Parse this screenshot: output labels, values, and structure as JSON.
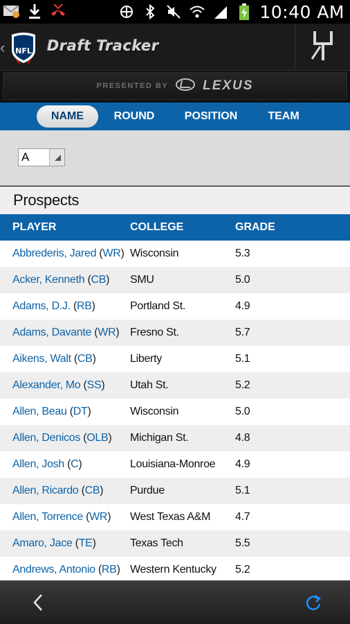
{
  "status_bar": {
    "time": "10:40 AM",
    "icons": [
      "gmail-icon",
      "download-icon",
      "missed-call-icon",
      "nfc-icon",
      "bluetooth-icon",
      "mute-icon",
      "wifi-icon",
      "signal-icon",
      "battery-charging-icon"
    ]
  },
  "header": {
    "title": "Draft Tracker",
    "logo": "nfl-shield-logo",
    "sponsor_label": "PRESENTED BY",
    "sponsor_name": "LEXUS"
  },
  "tabs": [
    {
      "label": "NAME",
      "active": true
    },
    {
      "label": "ROUND",
      "active": false
    },
    {
      "label": "POSITION",
      "active": false
    },
    {
      "label": "TEAM",
      "active": false
    }
  ],
  "filter": {
    "selected_letter": "A"
  },
  "prospects": {
    "title": "Prospects",
    "columns": {
      "player": "PLAYER",
      "college": "COLLEGE",
      "grade": "GRADE"
    },
    "rows": [
      {
        "name": "Abbrederis, Jared",
        "pos": "WR",
        "college": "Wisconsin",
        "grade": "5.3"
      },
      {
        "name": "Acker, Kenneth",
        "pos": "CB",
        "college": "SMU",
        "grade": "5.0"
      },
      {
        "name": "Adams, D.J.",
        "pos": "RB",
        "college": "Portland St.",
        "grade": "4.9"
      },
      {
        "name": "Adams, Davante",
        "pos": "WR",
        "college": "Fresno St.",
        "grade": "5.7"
      },
      {
        "name": "Aikens, Walt",
        "pos": "CB",
        "college": "Liberty",
        "grade": "5.1"
      },
      {
        "name": "Alexander, Mo",
        "pos": "SS",
        "college": "Utah St.",
        "grade": "5.2"
      },
      {
        "name": "Allen, Beau",
        "pos": "DT",
        "college": "Wisconsin",
        "grade": "5.0"
      },
      {
        "name": "Allen, Denicos",
        "pos": "OLB",
        "college": "Michigan St.",
        "grade": "4.8"
      },
      {
        "name": "Allen, Josh",
        "pos": "C",
        "college": "Louisiana-Monroe",
        "grade": "4.9"
      },
      {
        "name": "Allen, Ricardo",
        "pos": "CB",
        "college": "Purdue",
        "grade": "5.1"
      },
      {
        "name": "Allen, Torrence",
        "pos": "WR",
        "college": "West Texas A&M",
        "grade": "4.7"
      },
      {
        "name": "Amaro, Jace",
        "pos": "TE",
        "college": "Texas Tech",
        "grade": "5.5"
      },
      {
        "name": "Andrews, Antonio",
        "pos": "RB",
        "college": "Western Kentucky",
        "grade": "5.2"
      }
    ]
  },
  "colors": {
    "accent_blue": "#0d63a8",
    "link_blue": "#0d63a8",
    "refresh_blue": "#1e90ff"
  },
  "nav": {
    "back_icon": "back-arrow-icon",
    "refresh_icon": "refresh-icon"
  }
}
